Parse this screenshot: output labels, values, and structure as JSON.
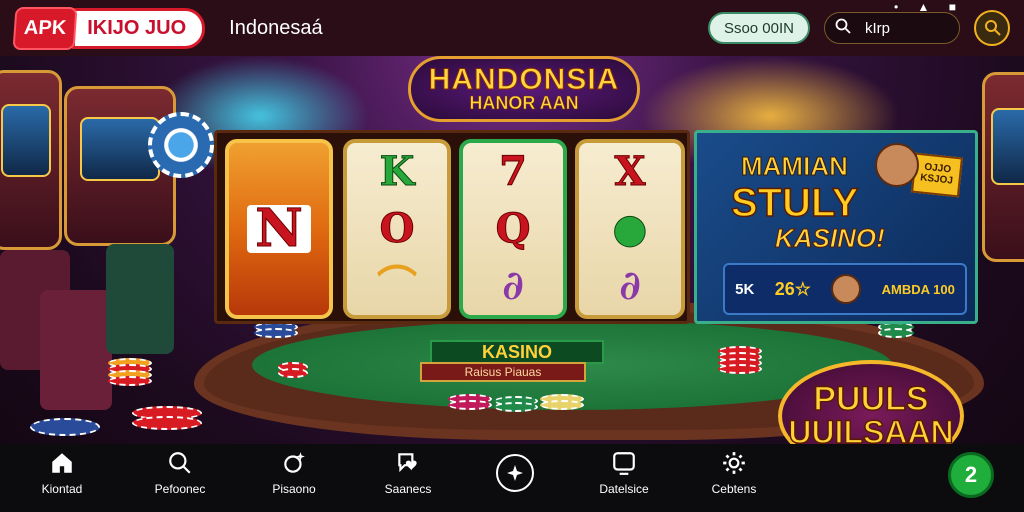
{
  "header": {
    "logo_badge": "APK",
    "logo_name": "IKIJO JUO",
    "title": "Indonesaá",
    "pill_button": "Ssoo 00IN",
    "search_text": "kIrp",
    "status_text": "• ▲ ■"
  },
  "hero": {
    "title_line1": "HANDONSIA",
    "title_line2": "HANOR AAN"
  },
  "reels": {
    "reel1": [
      "N"
    ],
    "reel2": [
      "K",
      "O",
      "⌒"
    ],
    "reel3": [
      "7",
      "Q",
      "∂"
    ],
    "reel4": [
      "X",
      "●",
      "∂"
    ]
  },
  "promo": {
    "line1": "MAMIAN",
    "line2": "STULY",
    "line3": "KASINO!",
    "tag": "OJJO KSJOJ",
    "row_item1": "5K",
    "row_item2": "26☆",
    "row_item3": "AMBDA 100"
  },
  "table": {
    "sign": "KASINO",
    "sub_sign": "Raisus Piauas"
  },
  "badge": {
    "line1": "PUULS",
    "line2": "UUILSAAN"
  },
  "bottom_nav": {
    "items": [
      {
        "label": "Kiontad",
        "icon": "home-icon"
      },
      {
        "label": "Pefoonec",
        "icon": "search-icon"
      },
      {
        "label": "Pisaono",
        "icon": "sparkle-icon"
      },
      {
        "label": "Saanecs",
        "icon": "chat-heart-icon"
      },
      {
        "label": "Datelsice",
        "icon": "screen-icon"
      },
      {
        "label": "Cebtens",
        "icon": "gear-icon"
      }
    ],
    "fab_label": "2"
  },
  "colors": {
    "accent_gold": "#ffd23a",
    "brand_red": "#d8192a",
    "fab_green": "#1fae3c"
  }
}
